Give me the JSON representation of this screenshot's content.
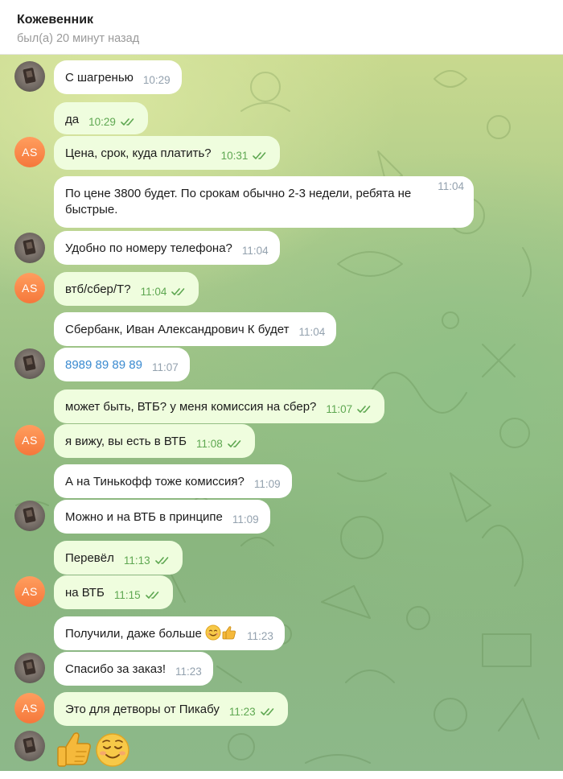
{
  "header": {
    "name": "Кожевенник",
    "status": "был(а) 20 минут назад"
  },
  "avatar_initials": "AS",
  "messages": [
    {
      "text": "С шагренью",
      "time": "10:29"
    },
    {
      "text": "да",
      "time": "10:29"
    },
    {
      "text": "Цена, срок, куда платить?",
      "time": "10:31"
    },
    {
      "text": "По цене 3800 будет. По срокам обычно 2-3 недели, ребята не быстрые.",
      "line1": "По цене 3800 будет. По срокам обычно 2-3 недели, ребята не",
      "line2": "быстрые.",
      "time": "11:04"
    },
    {
      "text": "Удобно по номеру телефона?",
      "time": "11:04"
    },
    {
      "text": "втб/сбер/Т?",
      "time": "11:04"
    },
    {
      "text": "Сбербанк, Иван Александрович К будет",
      "time": "11:04"
    },
    {
      "text": "8989 89 89 89",
      "time": "11:07"
    },
    {
      "text": "может быть, ВТБ? у меня комиссия на сбер?",
      "time": "11:07"
    },
    {
      "text": "я вижу, вы есть в ВТБ",
      "time": "11:08"
    },
    {
      "text": "А на Тинькофф тоже комиссия?",
      "time": "11:09"
    },
    {
      "text": "Можно и на ВТБ в принципе",
      "time": "11:09"
    },
    {
      "text": "Перевёл",
      "time": "11:13"
    },
    {
      "text": "на ВТБ",
      "time": "11:15"
    },
    {
      "text": "Получили, даже больше",
      "time": "11:23"
    },
    {
      "text": "Спасибо за заказ!",
      "time": "11:23"
    },
    {
      "text": "Это для детворы от Пикабу",
      "time": "11:23"
    }
  ],
  "colors": {
    "incoming": "#ffffff",
    "outgoing": "#effdde",
    "avatar_as": "#f5773b",
    "check": "#5ea751",
    "link": "#3a8ad0"
  },
  "icons": [
    "double-check-icon",
    "smiling-face-emoji",
    "thumbs-up-emoji"
  ]
}
